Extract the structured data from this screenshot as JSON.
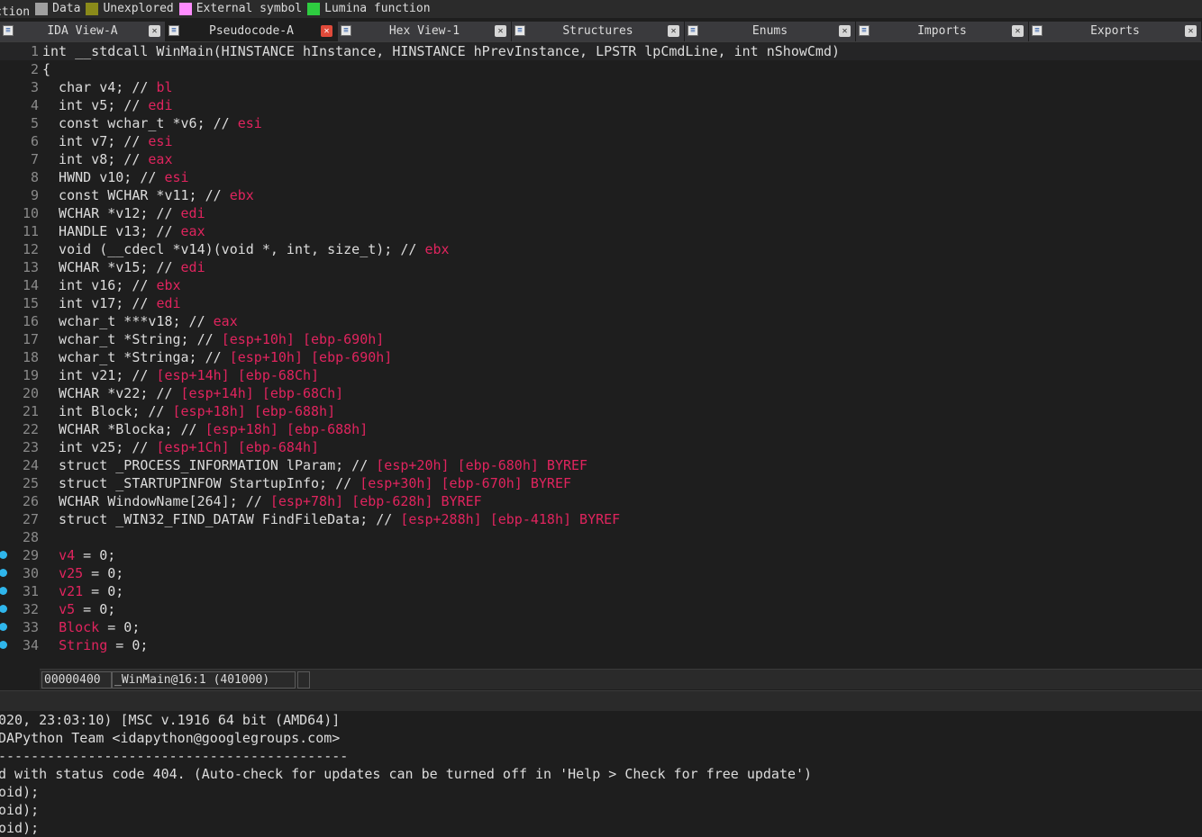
{
  "legend": [
    {
      "label": "ction",
      "color": ""
    },
    {
      "label": "Data",
      "color": "#a0a0a0"
    },
    {
      "label": "Unexplored",
      "color": "#8a8a1a"
    },
    {
      "label": "External symbol",
      "color": "#ff8cff"
    },
    {
      "label": "Lumina function",
      "color": "#2ecc40"
    }
  ],
  "tabs": [
    {
      "label": "IDA View-A",
      "icon": "disasm-view-icon",
      "active": false
    },
    {
      "label": "Pseudocode-A",
      "icon": "pseudocode-icon",
      "active": true
    },
    {
      "label": "Hex View-1",
      "icon": "hex-view-icon",
      "active": false
    },
    {
      "label": "Structures",
      "icon": "structures-icon",
      "active": false
    },
    {
      "label": "Enums",
      "icon": "enums-icon",
      "active": false
    },
    {
      "label": "Imports",
      "icon": "imports-icon",
      "active": false
    },
    {
      "label": "Exports",
      "icon": "exports-icon",
      "active": false
    }
  ],
  "code_lines": [
    {
      "n": "1",
      "dot": false,
      "parts": [
        [
          "kw",
          "int __stdcall WinMain(HINSTANCE hInstance, HINSTANCE hPrevInstance, LPSTR lpCmdLine, int nShowCmd)"
        ]
      ]
    },
    {
      "n": "2",
      "dot": false,
      "parts": [
        [
          "kw",
          "{"
        ]
      ]
    },
    {
      "n": "3",
      "dot": false,
      "parts": [
        [
          "kw",
          "  char v4; // "
        ],
        [
          "reg",
          "bl"
        ]
      ]
    },
    {
      "n": "4",
      "dot": false,
      "parts": [
        [
          "kw",
          "  int v5; // "
        ],
        [
          "reg",
          "edi"
        ]
      ]
    },
    {
      "n": "5",
      "dot": false,
      "parts": [
        [
          "kw",
          "  const wchar_t *v6; // "
        ],
        [
          "reg",
          "esi"
        ]
      ]
    },
    {
      "n": "6",
      "dot": false,
      "parts": [
        [
          "kw",
          "  int v7; // "
        ],
        [
          "reg",
          "esi"
        ]
      ]
    },
    {
      "n": "7",
      "dot": false,
      "parts": [
        [
          "kw",
          "  int v8; // "
        ],
        [
          "reg",
          "eax"
        ]
      ]
    },
    {
      "n": "8",
      "dot": false,
      "parts": [
        [
          "kw",
          "  HWND v10; // "
        ],
        [
          "reg",
          "esi"
        ]
      ]
    },
    {
      "n": "9",
      "dot": false,
      "parts": [
        [
          "kw",
          "  const WCHAR *v11; // "
        ],
        [
          "reg",
          "ebx"
        ]
      ]
    },
    {
      "n": "10",
      "dot": false,
      "parts": [
        [
          "kw",
          "  WCHAR *v12; // "
        ],
        [
          "reg",
          "edi"
        ]
      ]
    },
    {
      "n": "11",
      "dot": false,
      "parts": [
        [
          "kw",
          "  HANDLE v13; // "
        ],
        [
          "reg",
          "eax"
        ]
      ]
    },
    {
      "n": "12",
      "dot": false,
      "parts": [
        [
          "kw",
          "  void (__cdecl *v14)(void *, int, size_t); // "
        ],
        [
          "reg",
          "ebx"
        ]
      ]
    },
    {
      "n": "13",
      "dot": false,
      "parts": [
        [
          "kw",
          "  WCHAR *v15; // "
        ],
        [
          "reg",
          "edi"
        ]
      ]
    },
    {
      "n": "14",
      "dot": false,
      "parts": [
        [
          "kw",
          "  int v16; // "
        ],
        [
          "reg",
          "ebx"
        ]
      ]
    },
    {
      "n": "15",
      "dot": false,
      "parts": [
        [
          "kw",
          "  int v17; // "
        ],
        [
          "reg",
          "edi"
        ]
      ]
    },
    {
      "n": "16",
      "dot": false,
      "parts": [
        [
          "kw",
          "  wchar_t ***v18; // "
        ],
        [
          "reg",
          "eax"
        ]
      ]
    },
    {
      "n": "17",
      "dot": false,
      "parts": [
        [
          "kw",
          "  wchar_t *String; // "
        ],
        [
          "reg",
          "[esp+10h] [ebp-690h]"
        ]
      ]
    },
    {
      "n": "18",
      "dot": false,
      "parts": [
        [
          "kw",
          "  wchar_t *Stringa; // "
        ],
        [
          "reg",
          "[esp+10h] [ebp-690h]"
        ]
      ]
    },
    {
      "n": "19",
      "dot": false,
      "parts": [
        [
          "kw",
          "  int v21; // "
        ],
        [
          "reg",
          "[esp+14h] [ebp-68Ch]"
        ]
      ]
    },
    {
      "n": "20",
      "dot": false,
      "parts": [
        [
          "kw",
          "  WCHAR *v22; // "
        ],
        [
          "reg",
          "[esp+14h] [ebp-68Ch]"
        ]
      ]
    },
    {
      "n": "21",
      "dot": false,
      "parts": [
        [
          "kw",
          "  int Block; // "
        ],
        [
          "reg",
          "[esp+18h] [ebp-688h]"
        ]
      ]
    },
    {
      "n": "22",
      "dot": false,
      "parts": [
        [
          "kw",
          "  WCHAR *Blocka; // "
        ],
        [
          "reg",
          "[esp+18h] [ebp-688h]"
        ]
      ]
    },
    {
      "n": "23",
      "dot": false,
      "parts": [
        [
          "kw",
          "  int v25; // "
        ],
        [
          "reg",
          "[esp+1Ch] [ebp-684h]"
        ]
      ]
    },
    {
      "n": "24",
      "dot": false,
      "parts": [
        [
          "kw",
          "  struct _PROCESS_INFORMATION lParam; // "
        ],
        [
          "reg",
          "[esp+20h] [ebp-680h] BYREF"
        ]
      ]
    },
    {
      "n": "25",
      "dot": false,
      "parts": [
        [
          "kw",
          "  struct _STARTUPINFOW StartupInfo; // "
        ],
        [
          "reg",
          "[esp+30h] [ebp-670h] BYREF"
        ]
      ]
    },
    {
      "n": "26",
      "dot": false,
      "parts": [
        [
          "kw",
          "  WCHAR WindowName[264]; // "
        ],
        [
          "reg",
          "[esp+78h] [ebp-628h] BYREF"
        ]
      ]
    },
    {
      "n": "27",
      "dot": false,
      "parts": [
        [
          "kw",
          "  struct _WIN32_FIND_DATAW FindFileData; // "
        ],
        [
          "reg",
          "[esp+288h] [ebp-418h] BYREF"
        ]
      ]
    },
    {
      "n": "28",
      "dot": false,
      "parts": [
        [
          "kw",
          ""
        ]
      ]
    },
    {
      "n": "29",
      "dot": true,
      "parts": [
        [
          "kw",
          "  "
        ],
        [
          "lvar",
          "v4"
        ],
        [
          "kw",
          " = 0;"
        ]
      ]
    },
    {
      "n": "30",
      "dot": true,
      "parts": [
        [
          "kw",
          "  "
        ],
        [
          "lvar",
          "v25"
        ],
        [
          "kw",
          " = 0;"
        ]
      ]
    },
    {
      "n": "31",
      "dot": true,
      "parts": [
        [
          "kw",
          "  "
        ],
        [
          "lvar",
          "v21"
        ],
        [
          "kw",
          " = 0;"
        ]
      ]
    },
    {
      "n": "32",
      "dot": true,
      "parts": [
        [
          "kw",
          "  "
        ],
        [
          "lvar",
          "v5"
        ],
        [
          "kw",
          " = 0;"
        ]
      ]
    },
    {
      "n": "33",
      "dot": true,
      "parts": [
        [
          "kw",
          "  "
        ],
        [
          "lvar",
          "Block"
        ],
        [
          "kw",
          " = 0;"
        ]
      ]
    },
    {
      "n": "34",
      "dot": true,
      "parts": [
        [
          "kw",
          "  "
        ],
        [
          "lvar",
          "String"
        ],
        [
          "kw",
          " = 0;"
        ]
      ]
    }
  ],
  "status": {
    "address": "00000400",
    "location": "_WinMain@16:1 (401000)"
  },
  "output_lines": [
    "020, 23:03:10) [MSC v.1916 64 bit (AMD64)]",
    "DAPython Team <idapython@googlegroups.com>",
    "-------------------------------------------",
    "d with status code 404. (Auto-check for updates can be turned off in 'Help > Check for free update')",
    "oid);",
    "oid);",
    "oid);"
  ],
  "colors": {
    "background": "#1e1e1e",
    "text": "#dcdcdc",
    "register_comment": "#e0245e",
    "breakpoint_dot": "#2fb6ec"
  }
}
